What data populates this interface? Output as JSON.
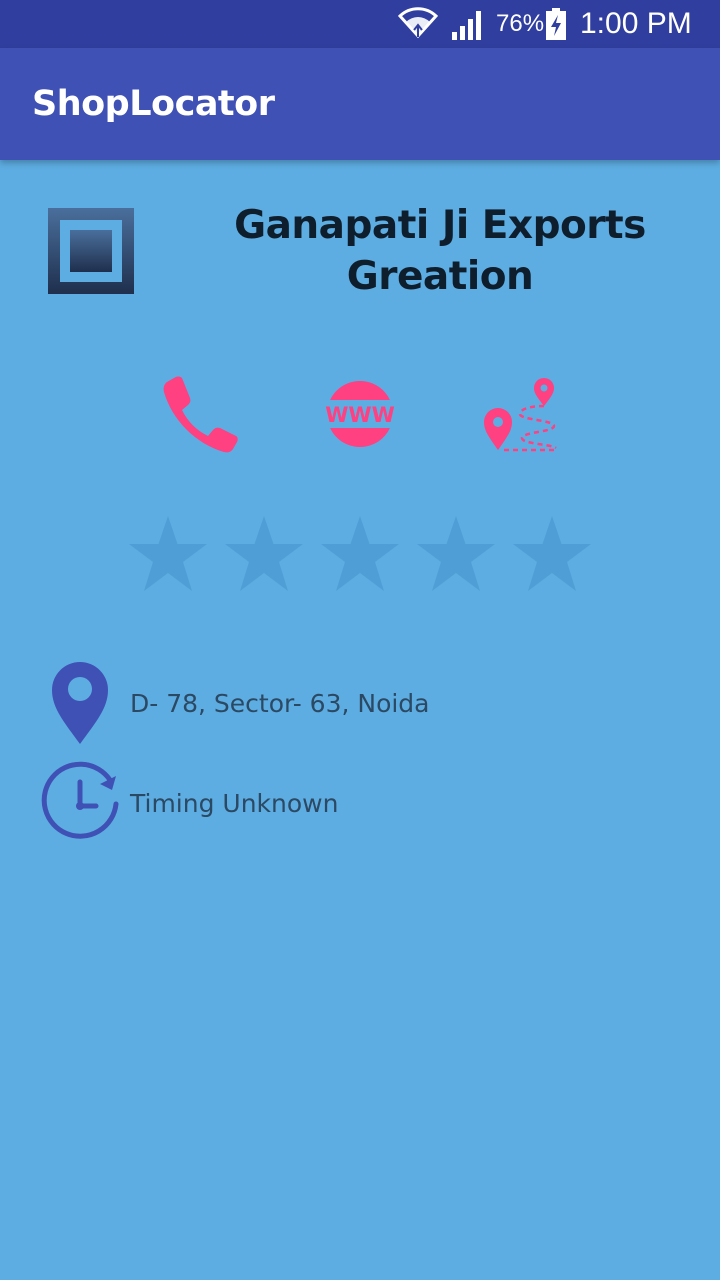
{
  "status_bar": {
    "battery": "76%",
    "time": "1:00 PM",
    "icons": [
      "wifi-icon",
      "signal-icon",
      "battery-charging-icon"
    ]
  },
  "app_bar": {
    "title": "ShopLocator"
  },
  "shop": {
    "name": "Ganapati Ji Exports Greation",
    "logo_icon": "shop-logo-icon"
  },
  "actions": [
    {
      "name": "call",
      "icon": "phone-icon"
    },
    {
      "name": "website",
      "icon": "www-icon"
    },
    {
      "name": "directions",
      "icon": "route-icon"
    }
  ],
  "rating": {
    "value": 0,
    "max": 5
  },
  "details": {
    "address": "D- 78, Sector- 63, Noida",
    "timing": "Timing Unknown"
  },
  "colors": {
    "status_bar": "#303f9f",
    "app_bar": "#3f51b5",
    "background": "#5dade2",
    "accent": "#ff4081",
    "icon_blue": "#3f51b5",
    "star_empty": "#4f9fd6"
  }
}
